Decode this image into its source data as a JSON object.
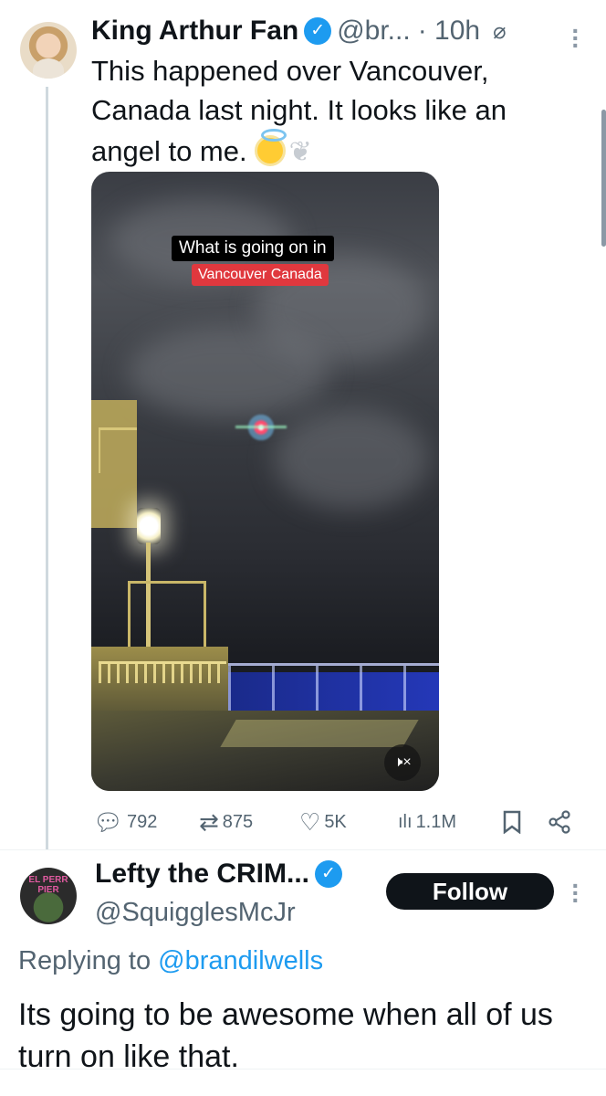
{
  "tweet": {
    "author_name": "King Arthur Fan",
    "handle": "@br...",
    "time": "· 10h",
    "verified_mark": "✓",
    "text": "This happened over Vancouver, Canada last night. It looks like an angel to me.",
    "video": {
      "caption_line1": "What is going on in",
      "caption_line2": "Vancouver Canada",
      "caption_line2_color": "#e0383e",
      "mute_label": "🕨×"
    },
    "stats": {
      "replies": "792",
      "reposts": "875",
      "likes": "5K",
      "views": "1.1M"
    }
  },
  "reply": {
    "author_name": "Lefty the CRIM...",
    "handle": "@SquigglesMcJr",
    "verified_mark": "✓",
    "follow_label": "Follow",
    "avatar_sign": "EL PERR PIER",
    "replying_prefix": "Replying to ",
    "replying_to": "@brandilwells",
    "text": "Its going to be awesome when all of us turn on like that."
  },
  "colors": {
    "verified_blue": "#1d9bf0",
    "secondary_text": "#536471",
    "primary_text": "#0f1419"
  }
}
